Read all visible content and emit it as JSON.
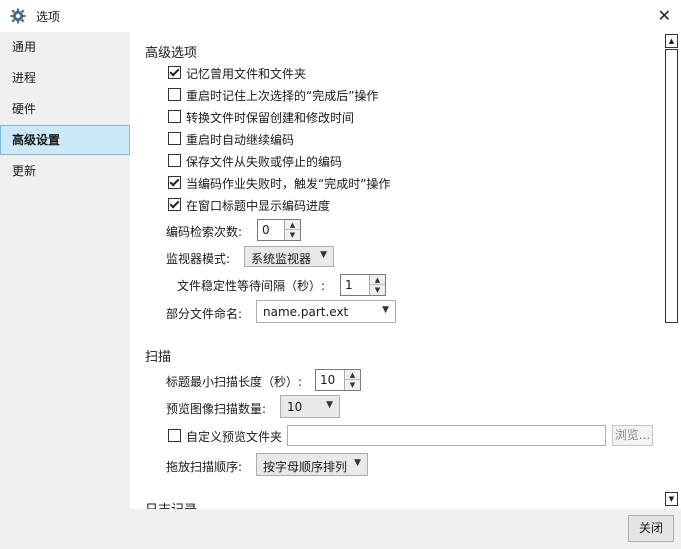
{
  "window": {
    "title": "选项",
    "icon": "gear-icon"
  },
  "sidebar": {
    "items": [
      {
        "label": "通用"
      },
      {
        "label": "进程"
      },
      {
        "label": "硬件"
      },
      {
        "label": "高级设置"
      },
      {
        "label": "更新"
      }
    ],
    "active": "高级设置"
  },
  "advanced": {
    "title": "高级选项",
    "checkboxes": [
      {
        "label": "记忆曾用文件和文件夹",
        "checked": true
      },
      {
        "label": "重启时记住上次选择的“完成后”操作",
        "checked": false
      },
      {
        "label": "转换文件时保留创建和修改时间",
        "checked": false
      },
      {
        "label": "重启时自动继续编码",
        "checked": false
      },
      {
        "label": "保存文件从失败或停止的编码",
        "checked": false
      },
      {
        "label": "当编码作业失败时，触发“完成时”操作",
        "checked": true
      },
      {
        "label": "在窗口标题中显示编码进度",
        "checked": true
      }
    ],
    "retry_label": "编码检索次数:",
    "retry_value": "0",
    "monitor_label": "监视器模式:",
    "monitor_value": "系统监视器",
    "stability_label": "文件稳定性等待间隔（秒）:",
    "stability_value": "1",
    "partial_label": "部分文件命名:",
    "partial_value": "name.part.ext"
  },
  "scan": {
    "title": "扫描",
    "min_length_label": "标题最小扫描长度（秒）:",
    "min_length_value": "10",
    "preview_count_label": "预览图像扫描数量:",
    "preview_count_value": "10",
    "custom_preview_label": "自定义预览文件夹",
    "custom_preview_checked": false,
    "custom_preview_path": "",
    "browse_label": "浏览...",
    "drop_order_label": "拖放扫描顺序:",
    "drop_order_value": "按字母顺序排列"
  },
  "log": {
    "title": "日志记录"
  },
  "footer": {
    "close_label": "关闭"
  }
}
